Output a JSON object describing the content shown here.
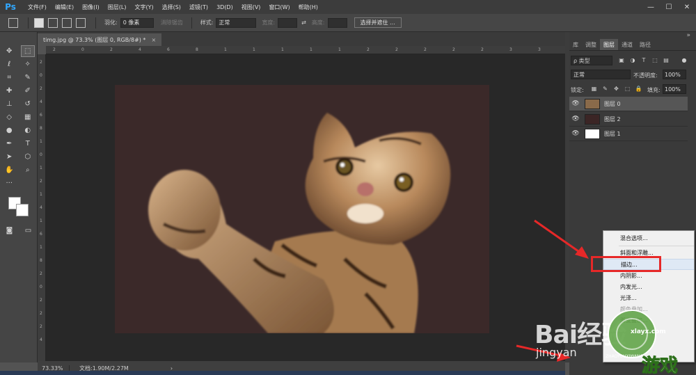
{
  "app": {
    "logo": "Ps"
  },
  "menubar": {
    "items": [
      "文件(F)",
      "编辑(E)",
      "图像(I)",
      "图层(L)",
      "文字(Y)",
      "选择(S)",
      "滤镜(T)",
      "3D(D)",
      "视图(V)",
      "窗口(W)",
      "帮助(H)"
    ],
    "window_controls": [
      "—",
      "☐",
      "✕"
    ]
  },
  "options": {
    "feather_label": "羽化:",
    "feather_value": "0 像素",
    "antialias_label": "消除锯齿",
    "style_label": "样式:",
    "style_value": "正常",
    "width_label": "宽度:",
    "height_label": "高度:",
    "select_mask_button": "选择并遮住 ..."
  },
  "document": {
    "tab_title": "timg.jpg @ 73.3% (图层 0, RGB/8#) *",
    "close": "×",
    "zoom": "73.33%",
    "doc_size": "文档:1.90M/2.27M",
    "status_arrow": "›"
  },
  "rulers": {
    "top": [
      "2",
      "0",
      "2",
      "4",
      "6",
      "8",
      "1",
      "1",
      "1",
      "1",
      "1",
      "2",
      "2",
      "2",
      "2",
      "2",
      "3",
      "3"
    ],
    "left": [
      "2",
      "0",
      "2",
      "4",
      "6",
      "8",
      "1",
      "0",
      "1",
      "2",
      "1",
      "4",
      "1",
      "6",
      "1",
      "8",
      "2",
      "0",
      "2",
      "2",
      "2",
      "4"
    ]
  },
  "panel": {
    "tabs": [
      "库",
      "调整",
      "图层",
      "通道",
      "路径"
    ],
    "active_tab": "图层",
    "filter_label": "ρ 类型",
    "blend_mode": "正常",
    "opacity_label": "不透明度:",
    "opacity_value": "100%",
    "lock_label": "锁定:",
    "fill_label": "填充:",
    "fill_value": "100%",
    "layers": [
      {
        "name": "图层 0",
        "thumb_color": "#8a6a4a",
        "selected": true
      },
      {
        "name": "图层 2",
        "thumb_color": "#3b2525",
        "selected": false
      },
      {
        "name": "图层 1",
        "thumb_color": "#ffffff",
        "selected": false
      }
    ]
  },
  "context_menu": {
    "items": [
      {
        "label": "混合选项...",
        "state": "normal"
      },
      {
        "label": "斜面和浮雕...",
        "state": "normal"
      },
      {
        "label": "描边...",
        "state": "hover"
      },
      {
        "label": "内阴影...",
        "state": "normal"
      },
      {
        "label": "内发光...",
        "state": "normal"
      },
      {
        "label": "光泽...",
        "state": "normal"
      },
      {
        "label": "颜色叠加...",
        "state": "disabled"
      },
      {
        "label": "渐变叠加...",
        "state": "disabled"
      }
    ]
  },
  "watermarks": {
    "baidu": "Bai经验",
    "jingyan": "jingyan",
    "site": "xlayx.com",
    "youxi": "游戏",
    "sub": "ZHAOYOUXIWANG"
  },
  "colors": {
    "canvas_bg": "#3b2929",
    "highlight": "#e62828",
    "accent": "#31a8ff"
  }
}
